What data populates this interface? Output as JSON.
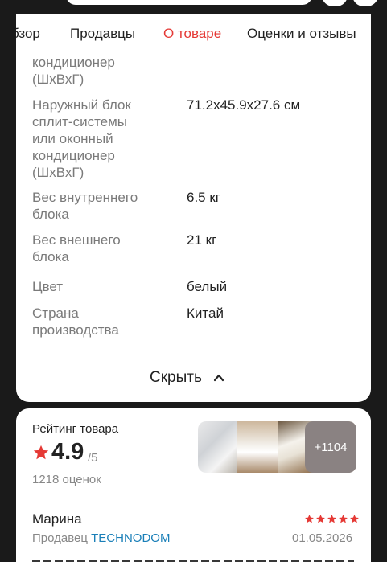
{
  "tabs": [
    {
      "label": "бзор"
    },
    {
      "label": "Продавцы"
    },
    {
      "label": "О товаре",
      "active": true
    },
    {
      "label": "Оценки и отзывы"
    }
  ],
  "specs": [
    {
      "label": "кондиционер\n(ШхВхГ)",
      "value": ""
    },
    {
      "label": "Наружный блок\nсплит-системы\nили оконный\nкондиционер\n(ШхВхГ)",
      "value": "71.2x45.9x27.6 см"
    },
    {
      "label": "Вес внутреннего\nблока",
      "value": "6.5 кг"
    },
    {
      "label": "Вес внешнего\nблока",
      "value": "21 кг"
    },
    {
      "label": "Цвет",
      "value": "белый"
    },
    {
      "label": "Страна\nпроизводства",
      "value": "Китай"
    }
  ],
  "hide_label": "Скрыть",
  "rating": {
    "title": "Рейтинг товара",
    "value": "4.9",
    "max": "/5",
    "count": "1218 оценок",
    "more_photos": "+1104"
  },
  "review": {
    "author": "Марина",
    "seller_prefix": "Продавец",
    "seller_name": "TECHNODOM",
    "date": "01.05.2026",
    "stars": 5
  },
  "colors": {
    "accent": "#e53935",
    "star": "#e53935",
    "link": "#1a7fb8"
  }
}
